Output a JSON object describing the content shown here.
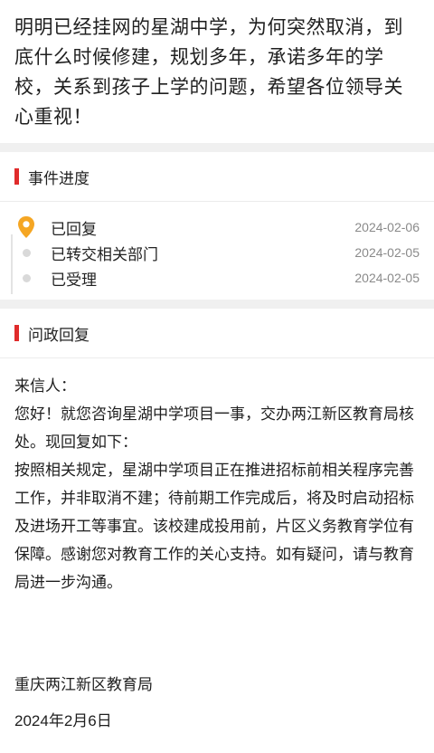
{
  "complaint": {
    "text": "明明已经挂网的星湖中学，为何突然取消，到底什么时候修建，规划多年，承诺多年的学校，关系到孩子上学的问题，希望各位领导关心重视！"
  },
  "progress": {
    "title": "事件进度",
    "items": [
      {
        "label": "已回复",
        "date": "2024-02-06",
        "icon": "location-pin-icon"
      },
      {
        "label": "已转交相关部门",
        "date": "2024-02-05",
        "icon": "dot"
      },
      {
        "label": "已受理",
        "date": "2024-02-05",
        "icon": "dot"
      }
    ],
    "colors": {
      "accent": "#f5a623",
      "bar": "#e02b2b"
    }
  },
  "reply": {
    "title": "问政回复",
    "salutation": "来信人：",
    "paragraph1": "您好！就您咨询星湖中学项目一事，交办两江新区教育局核处。现回复如下：",
    "paragraph2": "按照相关规定，星湖中学项目正在推进招标前相关程序完善工作，并非取消不建；待前期工作完成后，将及时启动招标及进场开工等事宜。该校建成投用前，片区义务教育学位有保障。感谢您对教育工作的关心支持。如有疑问，请与教育局进一步沟通。",
    "signature": "重庆两江新区教育局",
    "date": "2024年2月6日"
  }
}
